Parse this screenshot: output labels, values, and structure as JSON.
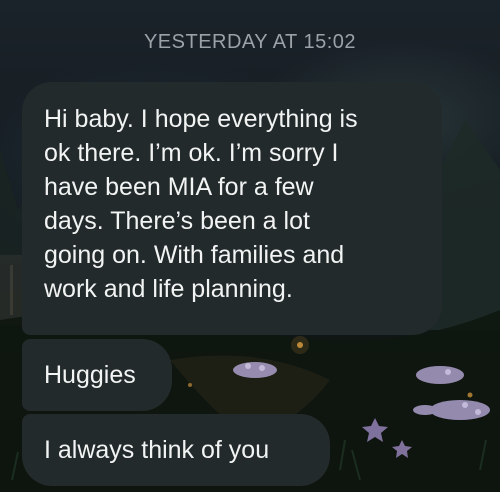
{
  "conversation": {
    "timestamp": "YESTERDAY AT 15:02",
    "messages": [
      {
        "text": "Hi baby. I hope everything is\nok there. I’m ok. I’m sorry I\nhave been MIA for a few\ndays. There’s been a lot\ngoing on. With families and\nwork and life planning."
      },
      {
        "text": "Huggies"
      },
      {
        "text": "I always think of you"
      }
    ]
  },
  "colors": {
    "bubble": "#232a2b",
    "text": "#f2f4f3",
    "timestamp": "#9aa3a8"
  }
}
